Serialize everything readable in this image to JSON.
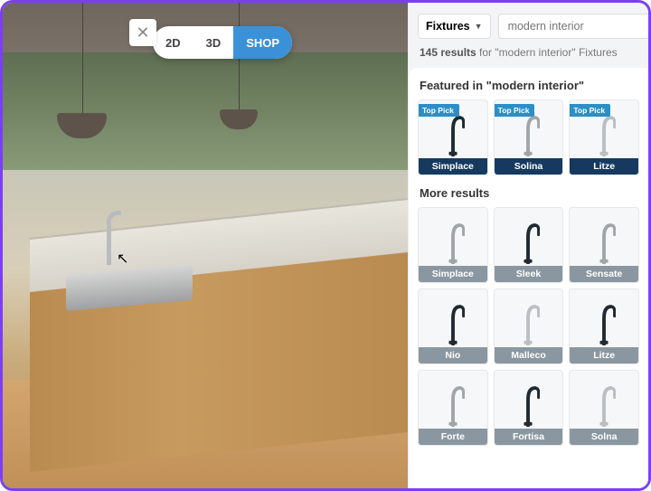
{
  "view_toggle": {
    "btn_2d": "2D",
    "btn_3d": "3D",
    "btn_shop": "SHOP"
  },
  "close_glyph": "✕",
  "search": {
    "category_label": "Fixtures",
    "placeholder": "modern interior",
    "results_count": "145 results",
    "results_suffix": " for \"modern interior\" Fixtures"
  },
  "sections": {
    "featured_title": "Featured in \"modern interior\"",
    "more_title": "More results"
  },
  "featured_badge": "Top Pick",
  "featured": [
    {
      "name": "Simplace",
      "tone": "#1f2a33"
    },
    {
      "name": "Solina",
      "tone": "#9fa6aa"
    },
    {
      "name": "Litze",
      "tone": "#b9bfc2"
    }
  ],
  "results": [
    {
      "name": "Simplace",
      "tone": "#9fa6aa"
    },
    {
      "name": "Sleek",
      "tone": "#1f2a33"
    },
    {
      "name": "Sensate",
      "tone": "#9fa6aa"
    },
    {
      "name": "Nio",
      "tone": "#1f2a33"
    },
    {
      "name": "Malleco",
      "tone": "#b9bfc2"
    },
    {
      "name": "Litze",
      "tone": "#1f2a33"
    },
    {
      "name": "Forte",
      "tone": "#9fa6aa"
    },
    {
      "name": "Fortisa",
      "tone": "#1f2a33"
    },
    {
      "name": "Solna",
      "tone": "#b9bfc2"
    }
  ]
}
